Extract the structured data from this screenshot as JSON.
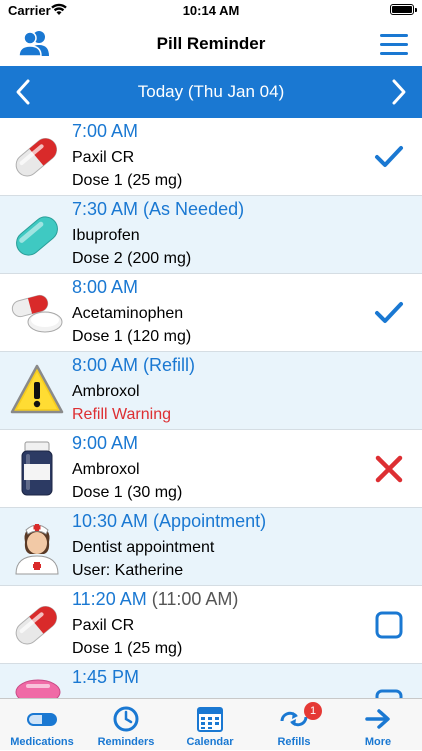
{
  "status_bar": {
    "carrier": "Carrier",
    "time": "10:14 AM"
  },
  "nav": {
    "title": "Pill Reminder",
    "left_icon": "users-icon",
    "right_icon": "menu-icon"
  },
  "date_bar": {
    "label": "Today (Thu Jan 04)"
  },
  "reminders": [
    {
      "time": "7:00 AM",
      "time_extra": "",
      "name": "Paxil CR",
      "dose": "Dose 1 (25 mg)",
      "icon": "red-white-capsule-icon",
      "status": "checkmark-icon"
    },
    {
      "time": "7:30 AM (As Needed)",
      "time_extra": "",
      "name": "Ibuprofen",
      "dose": "Dose 2 (200 mg)",
      "icon": "teal-tablet-icon",
      "status": ""
    },
    {
      "time": "8:00 AM",
      "time_extra": "",
      "name": "Acetaminophen",
      "dose": "Dose 1 (120 mg)",
      "icon": "capsule-and-pill-icon",
      "status": "checkmark-icon"
    },
    {
      "time": "8:00 AM (Refill)",
      "time_extra": "",
      "name": "Ambroxol",
      "dose": "Refill Warning",
      "icon": "warning-icon",
      "status": ""
    },
    {
      "time": "9:00 AM",
      "time_extra": "",
      "name": "Ambroxol",
      "dose": "Dose 1 (30 mg)",
      "icon": "pill-bottle-icon",
      "status": "x-mark-icon"
    },
    {
      "time": "10:30 AM (Appointment)",
      "time_extra": "",
      "name": "Dentist appointment",
      "dose": "User: Katherine",
      "icon": "nurse-icon",
      "status": ""
    },
    {
      "time": "11:20 AM",
      "time_extra": " (11:00 AM)",
      "name": "Paxil CR",
      "dose": "Dose 1 (25 mg)",
      "icon": "red-white-capsule-icon",
      "status": "checkbox-icon"
    },
    {
      "time": "1:45 PM",
      "time_extra": "",
      "name": "",
      "dose": "",
      "icon": "pink-tablet-icon",
      "status": "checkbox-icon"
    }
  ],
  "tabs": [
    {
      "label": "Medications",
      "icon": "pill-icon"
    },
    {
      "label": "Reminders",
      "icon": "clock-icon"
    },
    {
      "label": "Calendar",
      "icon": "calendar-icon"
    },
    {
      "label": "Refills",
      "icon": "refill-icon",
      "badge": "1"
    },
    {
      "label": "More",
      "icon": "arrow-right-icon"
    }
  ],
  "colors": {
    "accent": "#1a78d2",
    "alt_row": "#e9f4fb",
    "warning_text": "#dd2f33",
    "cancel": "#dd2f33"
  }
}
